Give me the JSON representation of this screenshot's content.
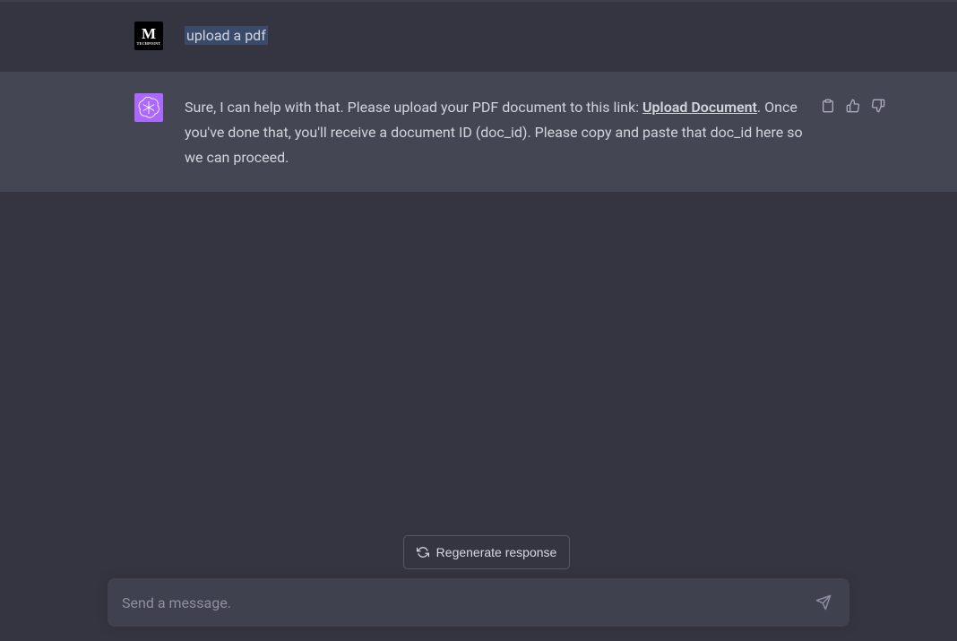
{
  "user_message": {
    "text": "upload a pdf",
    "avatar_big": "M",
    "avatar_small": "TECHPOINT"
  },
  "assistant_message": {
    "text_part1": "Sure, I can help with that. Please upload your PDF document to this link: ",
    "link_text": "Upload Document",
    "text_part2": ". Once you've done that, you'll receive a document ID (doc_id). Please copy and paste that doc_id here so we can proceed."
  },
  "regenerate_label": "Regenerate response",
  "input_placeholder": "Send a message."
}
